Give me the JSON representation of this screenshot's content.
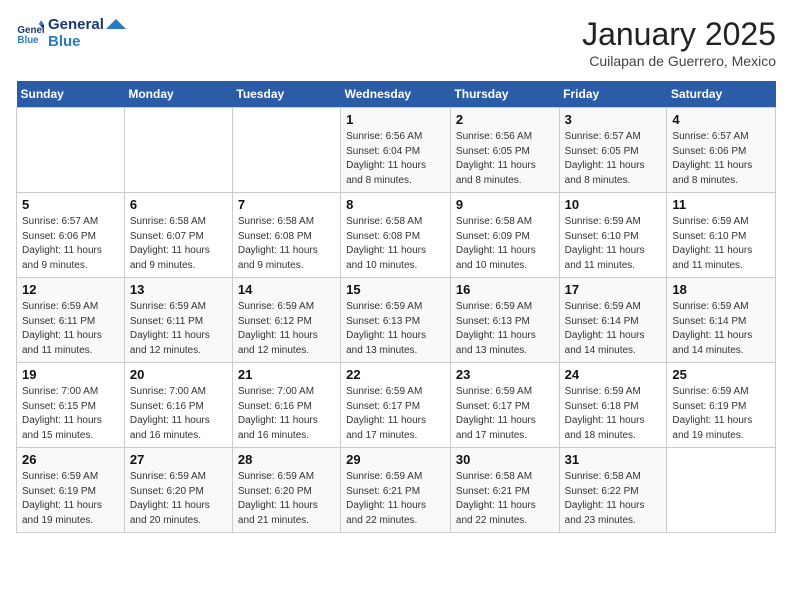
{
  "header": {
    "logo_line1": "General",
    "logo_line2": "Blue",
    "title": "January 2025",
    "subtitle": "Cuilapan de Guerrero, Mexico"
  },
  "days_of_week": [
    "Sunday",
    "Monday",
    "Tuesday",
    "Wednesday",
    "Thursday",
    "Friday",
    "Saturday"
  ],
  "weeks": [
    [
      {
        "day": "",
        "info": ""
      },
      {
        "day": "",
        "info": ""
      },
      {
        "day": "",
        "info": ""
      },
      {
        "day": "1",
        "info": "Sunrise: 6:56 AM\nSunset: 6:04 PM\nDaylight: 11 hours and 8 minutes."
      },
      {
        "day": "2",
        "info": "Sunrise: 6:56 AM\nSunset: 6:05 PM\nDaylight: 11 hours and 8 minutes."
      },
      {
        "day": "3",
        "info": "Sunrise: 6:57 AM\nSunset: 6:05 PM\nDaylight: 11 hours and 8 minutes."
      },
      {
        "day": "4",
        "info": "Sunrise: 6:57 AM\nSunset: 6:06 PM\nDaylight: 11 hours and 8 minutes."
      }
    ],
    [
      {
        "day": "5",
        "info": "Sunrise: 6:57 AM\nSunset: 6:06 PM\nDaylight: 11 hours and 9 minutes."
      },
      {
        "day": "6",
        "info": "Sunrise: 6:58 AM\nSunset: 6:07 PM\nDaylight: 11 hours and 9 minutes."
      },
      {
        "day": "7",
        "info": "Sunrise: 6:58 AM\nSunset: 6:08 PM\nDaylight: 11 hours and 9 minutes."
      },
      {
        "day": "8",
        "info": "Sunrise: 6:58 AM\nSunset: 6:08 PM\nDaylight: 11 hours and 10 minutes."
      },
      {
        "day": "9",
        "info": "Sunrise: 6:58 AM\nSunset: 6:09 PM\nDaylight: 11 hours and 10 minutes."
      },
      {
        "day": "10",
        "info": "Sunrise: 6:59 AM\nSunset: 6:10 PM\nDaylight: 11 hours and 11 minutes."
      },
      {
        "day": "11",
        "info": "Sunrise: 6:59 AM\nSunset: 6:10 PM\nDaylight: 11 hours and 11 minutes."
      }
    ],
    [
      {
        "day": "12",
        "info": "Sunrise: 6:59 AM\nSunset: 6:11 PM\nDaylight: 11 hours and 11 minutes."
      },
      {
        "day": "13",
        "info": "Sunrise: 6:59 AM\nSunset: 6:11 PM\nDaylight: 11 hours and 12 minutes."
      },
      {
        "day": "14",
        "info": "Sunrise: 6:59 AM\nSunset: 6:12 PM\nDaylight: 11 hours and 12 minutes."
      },
      {
        "day": "15",
        "info": "Sunrise: 6:59 AM\nSunset: 6:13 PM\nDaylight: 11 hours and 13 minutes."
      },
      {
        "day": "16",
        "info": "Sunrise: 6:59 AM\nSunset: 6:13 PM\nDaylight: 11 hours and 13 minutes."
      },
      {
        "day": "17",
        "info": "Sunrise: 6:59 AM\nSunset: 6:14 PM\nDaylight: 11 hours and 14 minutes."
      },
      {
        "day": "18",
        "info": "Sunrise: 6:59 AM\nSunset: 6:14 PM\nDaylight: 11 hours and 14 minutes."
      }
    ],
    [
      {
        "day": "19",
        "info": "Sunrise: 7:00 AM\nSunset: 6:15 PM\nDaylight: 11 hours and 15 minutes."
      },
      {
        "day": "20",
        "info": "Sunrise: 7:00 AM\nSunset: 6:16 PM\nDaylight: 11 hours and 16 minutes."
      },
      {
        "day": "21",
        "info": "Sunrise: 7:00 AM\nSunset: 6:16 PM\nDaylight: 11 hours and 16 minutes."
      },
      {
        "day": "22",
        "info": "Sunrise: 6:59 AM\nSunset: 6:17 PM\nDaylight: 11 hours and 17 minutes."
      },
      {
        "day": "23",
        "info": "Sunrise: 6:59 AM\nSunset: 6:17 PM\nDaylight: 11 hours and 17 minutes."
      },
      {
        "day": "24",
        "info": "Sunrise: 6:59 AM\nSunset: 6:18 PM\nDaylight: 11 hours and 18 minutes."
      },
      {
        "day": "25",
        "info": "Sunrise: 6:59 AM\nSunset: 6:19 PM\nDaylight: 11 hours and 19 minutes."
      }
    ],
    [
      {
        "day": "26",
        "info": "Sunrise: 6:59 AM\nSunset: 6:19 PM\nDaylight: 11 hours and 19 minutes."
      },
      {
        "day": "27",
        "info": "Sunrise: 6:59 AM\nSunset: 6:20 PM\nDaylight: 11 hours and 20 minutes."
      },
      {
        "day": "28",
        "info": "Sunrise: 6:59 AM\nSunset: 6:20 PM\nDaylight: 11 hours and 21 minutes."
      },
      {
        "day": "29",
        "info": "Sunrise: 6:59 AM\nSunset: 6:21 PM\nDaylight: 11 hours and 22 minutes."
      },
      {
        "day": "30",
        "info": "Sunrise: 6:58 AM\nSunset: 6:21 PM\nDaylight: 11 hours and 22 minutes."
      },
      {
        "day": "31",
        "info": "Sunrise: 6:58 AM\nSunset: 6:22 PM\nDaylight: 11 hours and 23 minutes."
      },
      {
        "day": "",
        "info": ""
      }
    ]
  ]
}
